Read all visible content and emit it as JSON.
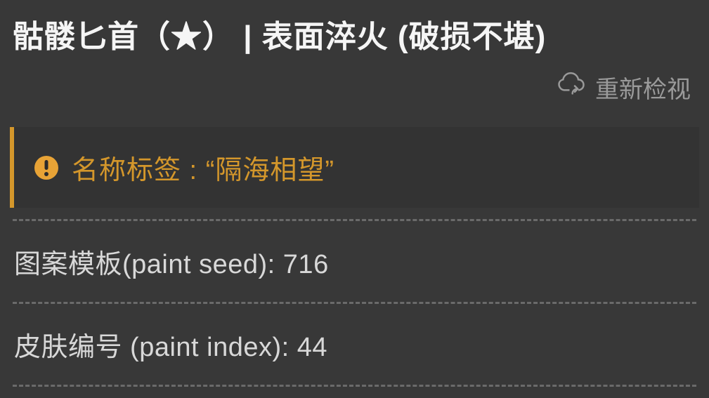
{
  "title": "骷髅匕首（★） | 表面淬火 (破损不堪)",
  "refresh": {
    "label": "重新检视"
  },
  "nametag": {
    "prefix": "名称标签 :",
    "value": "“隔海相望”"
  },
  "rows": {
    "paint_seed": {
      "label": "图案模板(paint seed):",
      "value": "716"
    },
    "paint_index": {
      "label": "皮肤编号 (paint index):",
      "value": "44"
    }
  }
}
